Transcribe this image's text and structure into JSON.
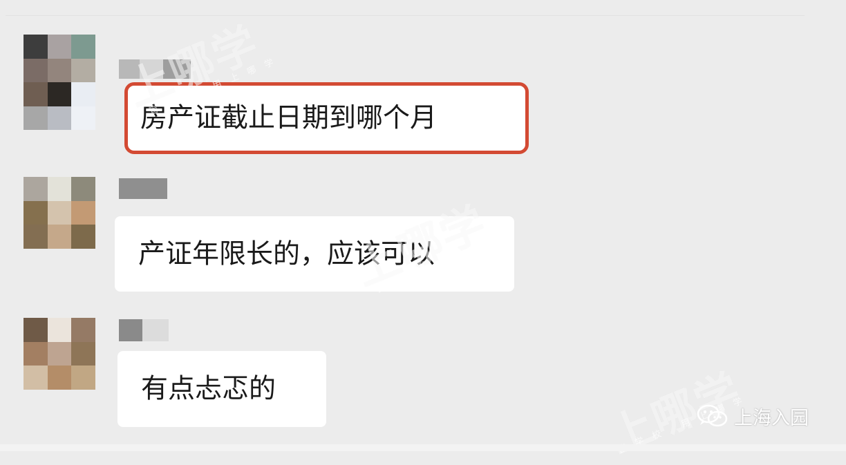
{
  "messages": [
    {
      "text": "房产证截止日期到哪个月",
      "highlighted": true
    },
    {
      "text": "产证年限长的，应该可以",
      "highlighted": false
    },
    {
      "text": "有点忐忑的",
      "highlighted": false
    }
  ],
  "watermark": {
    "brand": "上哪学",
    "sub": "管学校 用上哪学"
  },
  "source": {
    "label": "上海入园",
    "icon": "wechat-icon"
  },
  "colors": {
    "background": "#ececec",
    "bubble": "#ffffff",
    "highlight_border": "#d34a33"
  }
}
